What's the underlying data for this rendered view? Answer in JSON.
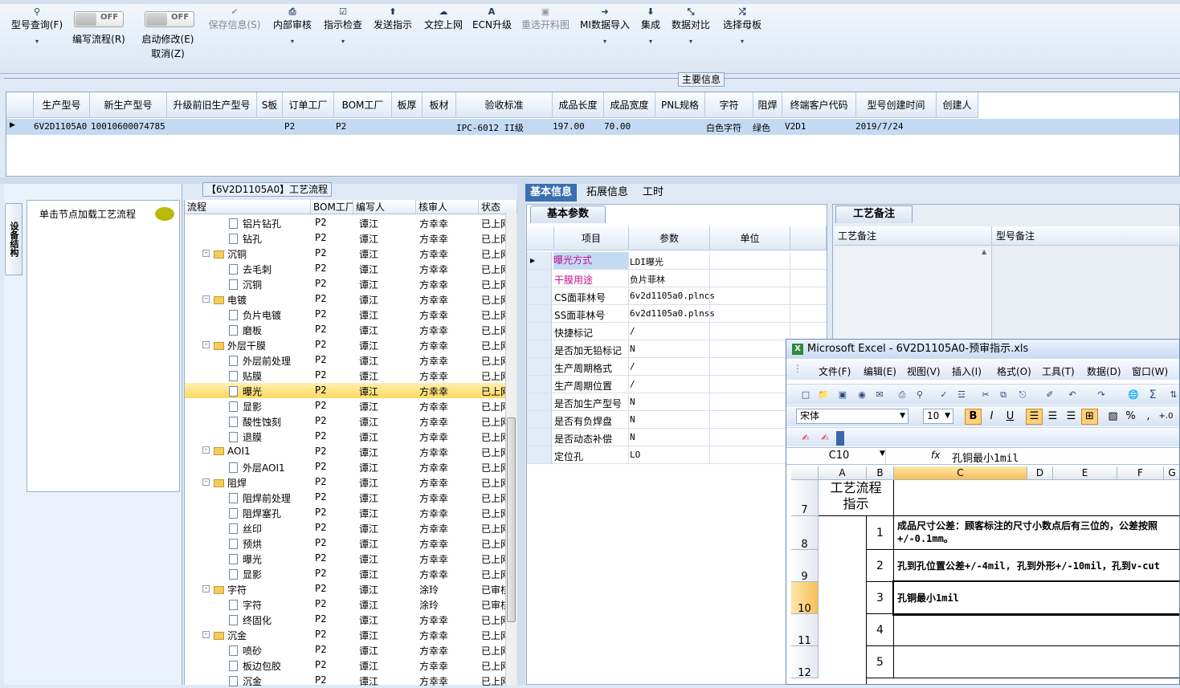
{
  "toolbar": {
    "buttons": [
      {
        "label": "型号查询(F)",
        "icon": "search-icon",
        "arrow": "▾"
      },
      {
        "label": "编写流程(R)",
        "toggle": "OFF"
      },
      {
        "label": "启动修改(E)",
        "label2": "取消(Z)",
        "toggle": "OFF"
      },
      {
        "label": "保存信息(S)",
        "icon": "check-icon",
        "disabled": true
      },
      {
        "label": "内部审核",
        "icon": "printer-icon",
        "arrow": "▾"
      },
      {
        "label": "指示检查",
        "icon": "checkbox-icon",
        "arrow": "▾"
      },
      {
        "label": "发送指示",
        "icon": "upload-icon"
      },
      {
        "label": "文控上网",
        "icon": "cloud-upload-icon"
      },
      {
        "label": "ECN升级",
        "icon": "ecn-icon"
      },
      {
        "label": "重选开料图",
        "icon": "image-icon",
        "disabled": true
      },
      {
        "label": "MI数据导入",
        "icon": "import-icon",
        "arrow": "▾"
      },
      {
        "label": "集成",
        "icon": "download-icon",
        "arrow": "▾"
      },
      {
        "label": "数据对比",
        "icon": "compare-icon",
        "arrow": "▾"
      },
      {
        "label": "选择母板",
        "icon": "shuffle-icon",
        "arrow": "▾"
      }
    ]
  },
  "main_info": {
    "title": "主要信息",
    "columns": [
      "生产型号",
      "新生产型号",
      "升级前旧生产型号",
      "S板",
      "订单工厂",
      "BOM工厂",
      "板厚",
      "板材",
      "验收标准",
      "成品长度",
      "成品宽度",
      "PNL规格",
      "字符",
      "阻焊",
      "终端客户代码",
      "型号创建时间",
      "创建人"
    ],
    "row": [
      "6V2D1105A0",
      "10010600074785",
      "",
      "",
      "P2",
      "P2",
      "",
      "",
      "IPC-6012 II级",
      "197.00",
      "70.00",
      "",
      "白色字符",
      "绿色",
      "V2D1",
      "2019/7/24",
      ""
    ]
  },
  "left_panel": {
    "vertical_tab": "设备结构",
    "hint": "单击节点加载工艺流程"
  },
  "process_tree": {
    "title": "【6V2D1105A0】工艺流程",
    "columns": [
      "流程",
      "BOM工厂",
      "编写人",
      "核审人",
      "状态"
    ],
    "rows": [
      {
        "name": "铝片钻孔",
        "type": "doc",
        "level": 2,
        "bom": "P2",
        "writer": "谭江",
        "reviewer": "方幸幸",
        "status": "已上网"
      },
      {
        "name": "钻孔",
        "type": "doc",
        "level": 2,
        "bom": "P2",
        "writer": "谭江",
        "reviewer": "方幸幸",
        "status": "已上网"
      },
      {
        "name": "沉铜",
        "type": "folder",
        "level": 1,
        "bom": "P2",
        "writer": "谭江",
        "reviewer": "方幸幸",
        "status": "已上网"
      },
      {
        "name": "去毛刺",
        "type": "doc",
        "level": 2,
        "bom": "P2",
        "writer": "谭江",
        "reviewer": "方幸幸",
        "status": "已上网"
      },
      {
        "name": "沉铜",
        "type": "doc",
        "level": 2,
        "bom": "P2",
        "writer": "谭江",
        "reviewer": "方幸幸",
        "status": "已上网"
      },
      {
        "name": "电镀",
        "type": "folder",
        "level": 1,
        "bom": "P2",
        "writer": "谭江",
        "reviewer": "方幸幸",
        "status": "已上网"
      },
      {
        "name": "负片电镀",
        "type": "doc",
        "level": 2,
        "bom": "P2",
        "writer": "谭江",
        "reviewer": "方幸幸",
        "status": "已上网"
      },
      {
        "name": "磨板",
        "type": "doc",
        "level": 2,
        "bom": "P2",
        "writer": "谭江",
        "reviewer": "方幸幸",
        "status": "已上网"
      },
      {
        "name": "外层干膜",
        "type": "folder",
        "level": 1,
        "bom": "P2",
        "writer": "谭江",
        "reviewer": "方幸幸",
        "status": "已上网"
      },
      {
        "name": "外层前处理",
        "type": "doc",
        "level": 2,
        "bom": "P2",
        "writer": "谭江",
        "reviewer": "方幸幸",
        "status": "已上网"
      },
      {
        "name": "贴膜",
        "type": "doc",
        "level": 2,
        "bom": "P2",
        "writer": "谭江",
        "reviewer": "方幸幸",
        "status": "已上网"
      },
      {
        "name": "曝光",
        "type": "doc",
        "level": 2,
        "bom": "P2",
        "writer": "谭江",
        "reviewer": "方幸幸",
        "status": "已上网",
        "selected": true
      },
      {
        "name": "显影",
        "type": "doc",
        "level": 2,
        "bom": "P2",
        "writer": "谭江",
        "reviewer": "方幸幸",
        "status": "已上网"
      },
      {
        "name": "酸性蚀刻",
        "type": "doc",
        "level": 2,
        "bom": "P2",
        "writer": "谭江",
        "reviewer": "方幸幸",
        "status": "已上网"
      },
      {
        "name": "退膜",
        "type": "doc",
        "level": 2,
        "bom": "P2",
        "writer": "谭江",
        "reviewer": "方幸幸",
        "status": "已上网"
      },
      {
        "name": "AOI1",
        "type": "folder",
        "level": 1,
        "bom": "P2",
        "writer": "谭江",
        "reviewer": "方幸幸",
        "status": "已上网"
      },
      {
        "name": "外层AOI1",
        "type": "doc",
        "level": 2,
        "bom": "P2",
        "writer": "谭江",
        "reviewer": "方幸幸",
        "status": "已上网"
      },
      {
        "name": "阻焊",
        "type": "folder",
        "level": 1,
        "bom": "P2",
        "writer": "谭江",
        "reviewer": "方幸幸",
        "status": "已上网"
      },
      {
        "name": "阻焊前处理",
        "type": "doc",
        "level": 2,
        "bom": "P2",
        "writer": "谭江",
        "reviewer": "方幸幸",
        "status": "已上网"
      },
      {
        "name": "阻焊塞孔",
        "type": "doc",
        "level": 2,
        "bom": "P2",
        "writer": "谭江",
        "reviewer": "方幸幸",
        "status": "已上网"
      },
      {
        "name": "丝印",
        "type": "doc",
        "level": 2,
        "bom": "P2",
        "writer": "谭江",
        "reviewer": "方幸幸",
        "status": "已上网"
      },
      {
        "name": "预烘",
        "type": "doc",
        "level": 2,
        "bom": "P2",
        "writer": "谭江",
        "reviewer": "方幸幸",
        "status": "已上网"
      },
      {
        "name": "曝光",
        "type": "doc",
        "level": 2,
        "bom": "P2",
        "writer": "谭江",
        "reviewer": "方幸幸",
        "status": "已上网"
      },
      {
        "name": "显影",
        "type": "doc",
        "level": 2,
        "bom": "P2",
        "writer": "谭江",
        "reviewer": "方幸幸",
        "status": "已上网"
      },
      {
        "name": "字符",
        "type": "folder",
        "level": 1,
        "bom": "P2",
        "writer": "谭江",
        "reviewer": "涂玲",
        "status": "已审核"
      },
      {
        "name": "字符",
        "type": "doc",
        "level": 2,
        "bom": "P2",
        "writer": "谭江",
        "reviewer": "涂玲",
        "status": "已审核"
      },
      {
        "name": "终固化",
        "type": "doc",
        "level": 2,
        "bom": "P2",
        "writer": "谭江",
        "reviewer": "方幸幸",
        "status": "已上网"
      },
      {
        "name": "沉金",
        "type": "folder",
        "level": 1,
        "bom": "P2",
        "writer": "谭江",
        "reviewer": "方幸幸",
        "status": "已上网"
      },
      {
        "name": "喷砂",
        "type": "doc",
        "level": 2,
        "bom": "P2",
        "writer": "谭江",
        "reviewer": "方幸幸",
        "status": "已上网"
      },
      {
        "name": "板边包胶",
        "type": "doc",
        "level": 2,
        "bom": "P2",
        "writer": "谭江",
        "reviewer": "方幸幸",
        "status": "已上网"
      },
      {
        "name": "沉金",
        "type": "doc",
        "level": 2,
        "bom": "P2",
        "writer": "谭江",
        "reviewer": "方幸幸",
        "status": "已上网"
      }
    ]
  },
  "right_tabs": [
    "基本信息",
    "拓展信息",
    "工时"
  ],
  "basic_params": {
    "tab": "基本参数",
    "columns": [
      "项目",
      "参数",
      "单位"
    ],
    "rows": [
      {
        "key": "曝光方式",
        "value": "LDI曝光",
        "highlight": true,
        "current": true
      },
      {
        "key": "干膜用途",
        "value": "负片菲林",
        "highlight": true
      },
      {
        "key": "CS面菲林号",
        "value": "6v2d1105a0.plncs"
      },
      {
        "key": "SS面菲林号",
        "value": "6v2d1105a0.plnss"
      },
      {
        "key": "快捷标记",
        "value": "/"
      },
      {
        "key": "是否加无铅标记",
        "value": "N"
      },
      {
        "key": "生产周期格式",
        "value": "/"
      },
      {
        "key": "生产周期位置",
        "value": "/"
      },
      {
        "key": "是否加生产型号",
        "value": "N"
      },
      {
        "key": "是否有负焊盘",
        "value": "N"
      },
      {
        "key": "是否动态补偿",
        "value": "N"
      },
      {
        "key": "定位孔",
        "value": "LO"
      }
    ]
  },
  "notes": {
    "tab": "工艺备注",
    "col1": "工艺备注",
    "col2": "型号备注"
  },
  "excel": {
    "title": "Microsoft Excel - 6V2D1105A0-预审指示.xls",
    "menu": [
      "文件(F)",
      "编辑(E)",
      "视图(V)",
      "插入(I)",
      "格式(O)",
      "工具(T)",
      "数据(D)",
      "窗口(W)"
    ],
    "font": "宋体",
    "font_size": "10",
    "cell_ref": "C10",
    "fx": "fx",
    "formula": "孔铜最小1mil",
    "columns": [
      "A",
      "B",
      "C",
      "D",
      "E",
      "F",
      "G"
    ],
    "rows": [
      "7",
      "8",
      "9",
      "10",
      "11",
      "12"
    ],
    "merged_title": "工艺流程指示",
    "items": [
      {
        "no": "1",
        "text": "成品尺寸公差：顾客标注的尺寸小数点后有三位的，公差按照+/-0.1mm。"
      },
      {
        "no": "2",
        "text": "孔到孔位置公差+/-4mil, 孔到外形+/-10mil，孔到v-cut"
      },
      {
        "no": "3",
        "text": "孔铜最小1mil"
      },
      {
        "no": "4",
        "text": ""
      },
      {
        "no": "5",
        "text": ""
      }
    ]
  }
}
